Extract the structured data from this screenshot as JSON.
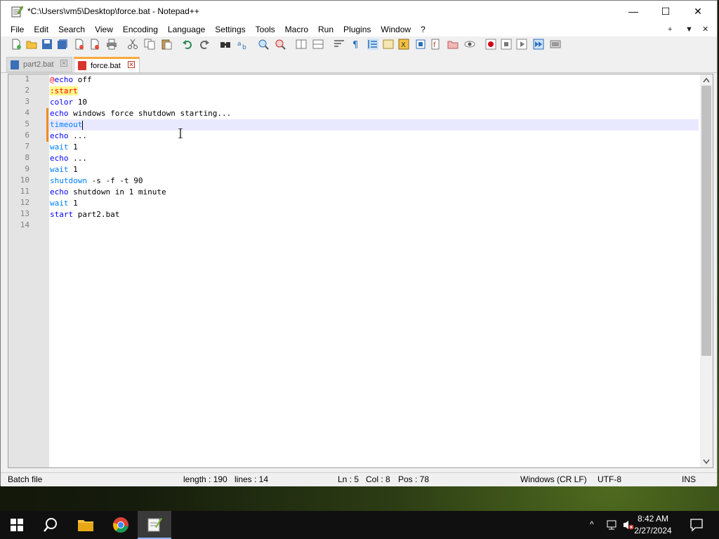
{
  "window": {
    "title": "*C:\\Users\\vm5\\Desktop\\force.bat - Notepad++",
    "controls": {
      "minimize": "—",
      "maximize": "☐",
      "close": "✕"
    }
  },
  "menu": {
    "items": [
      "File",
      "Edit",
      "Search",
      "View",
      "Encoding",
      "Language",
      "Settings",
      "Tools",
      "Macro",
      "Run",
      "Plugins",
      "Window",
      "?"
    ],
    "right": {
      "add": "+",
      "dropdown": "▼",
      "close": "✕"
    }
  },
  "tabs": [
    {
      "label": "part2.bat",
      "active": false
    },
    {
      "label": "force.bat",
      "active": true
    }
  ],
  "editor": {
    "line_numbers": [
      "1",
      "2",
      "3",
      "4",
      "5",
      "6",
      "7",
      "8",
      "9",
      "10",
      "11",
      "12",
      "13",
      "14"
    ],
    "lines": [
      [
        "@",
        "echo",
        " off"
      ],
      [
        ":start"
      ],
      [
        "color",
        " 10"
      ],
      [
        "echo",
        " windows force shutdown starting..."
      ],
      [
        "timeout"
      ],
      [
        "echo",
        " ..."
      ],
      [
        "wait",
        " 1"
      ],
      [
        "echo",
        " ..."
      ],
      [
        "wait",
        " 1"
      ],
      [
        "shutdown",
        " -s -f -t 90"
      ],
      [
        "echo",
        " shutdown in 1 minute"
      ],
      [
        "wait",
        " 1"
      ],
      [
        "start",
        " part2.bat"
      ],
      [
        ""
      ]
    ],
    "current_line": 5
  },
  "status": {
    "file_type": "Batch file",
    "length": "length : 190",
    "lines": "lines : 14",
    "ln": "Ln : 5",
    "col": "Col : 8",
    "pos": "Pos : 78",
    "eol": "Windows (CR LF)",
    "encoding": "UTF-8",
    "mode": "INS"
  },
  "taskbar": {
    "time": "8:42 AM",
    "date": "2/27/2024",
    "tray_chevron": "^"
  },
  "colors": {
    "tab_accent": "#f9a93b",
    "keyword": "#0000ff",
    "label": "#ff0000",
    "label_bg": "#fdf88c",
    "current_line": "#e8e8ff"
  }
}
